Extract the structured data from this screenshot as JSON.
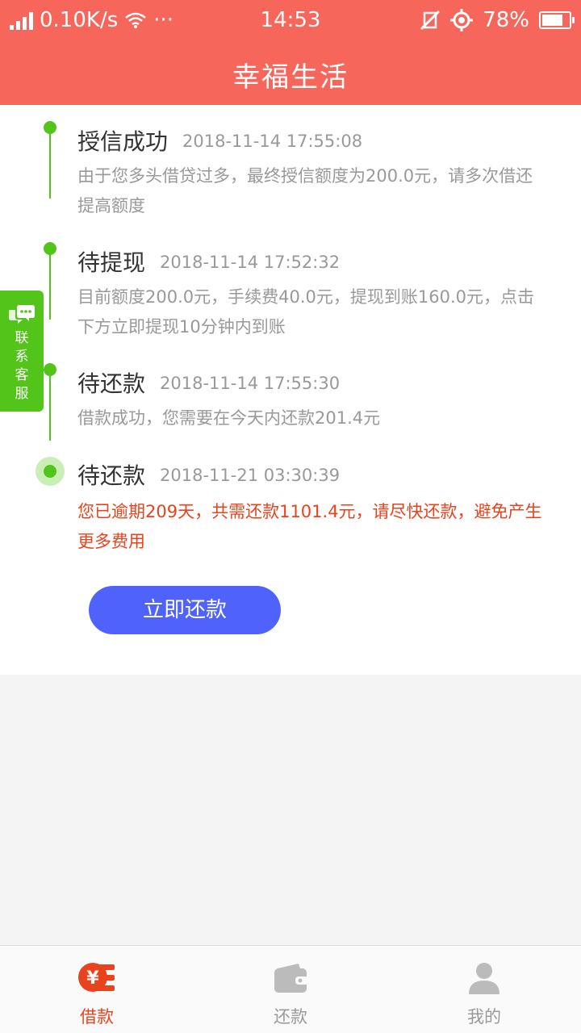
{
  "status_bar": {
    "network_speed": "0.10K/s",
    "more": "···",
    "time": "14:53",
    "battery": "78%",
    "battery_level": 0.78
  },
  "header": {
    "title": "幸福生活"
  },
  "timeline": [
    {
      "title": "授信成功",
      "time": "2018-11-14 17:55:08",
      "description": "由于您多头借贷过多，最终授信额度为200.0元，请多次借还提高额度",
      "status": "done"
    },
    {
      "title": "待提现",
      "time": "2018-11-14 17:52:32",
      "description": "目前额度200.0元，手续费40.0元，提现到账160.0元，点击下方立即提现10分钟内到账",
      "status": "done"
    },
    {
      "title": "待还款",
      "time": "2018-11-14 17:55:30",
      "description": "借款成功，您需要在今天内还款201.4元",
      "status": "done"
    },
    {
      "title": "待还款",
      "time": "2018-11-21 03:30:39",
      "description": "您已逾期209天，共需还款1101.4元，请尽快还款，避免产生更多费用",
      "status": "current"
    }
  ],
  "repay_button": {
    "label": "立即还款"
  },
  "service_tab": {
    "chars": [
      "联",
      "系",
      "客",
      "服"
    ]
  },
  "tabbar": {
    "items": [
      {
        "label": "借款",
        "icon": "loan-icon",
        "active": true
      },
      {
        "label": "还款",
        "icon": "wallet-icon",
        "active": false
      },
      {
        "label": "我的",
        "icon": "user-icon",
        "active": false
      }
    ]
  },
  "colors": {
    "header": "#f7665b",
    "timeline_green": "#52c41a",
    "alert": "#e8431c",
    "button": "#4f62fb"
  }
}
